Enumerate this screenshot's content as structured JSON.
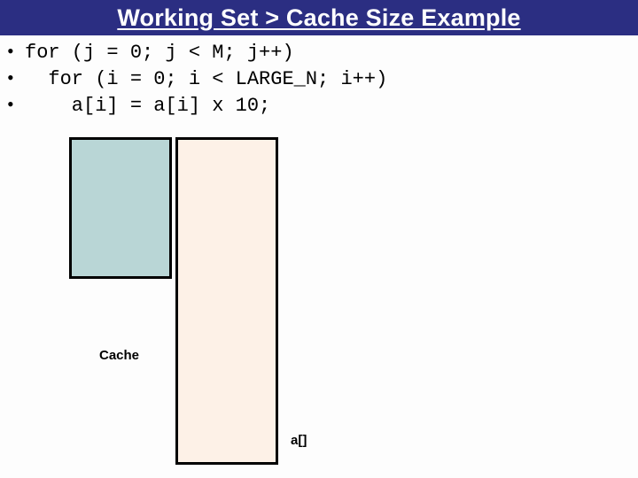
{
  "title": "Working Set > Cache Size Example",
  "code": {
    "bullet": "•",
    "line1": "for (j = 0; j < M; j++)",
    "line2": "  for (i = 0; i < LARGE_N; i++)",
    "line3": "    a[i] = a[i] x 10;"
  },
  "labels": {
    "cache": "Cache",
    "array": "a[]"
  }
}
